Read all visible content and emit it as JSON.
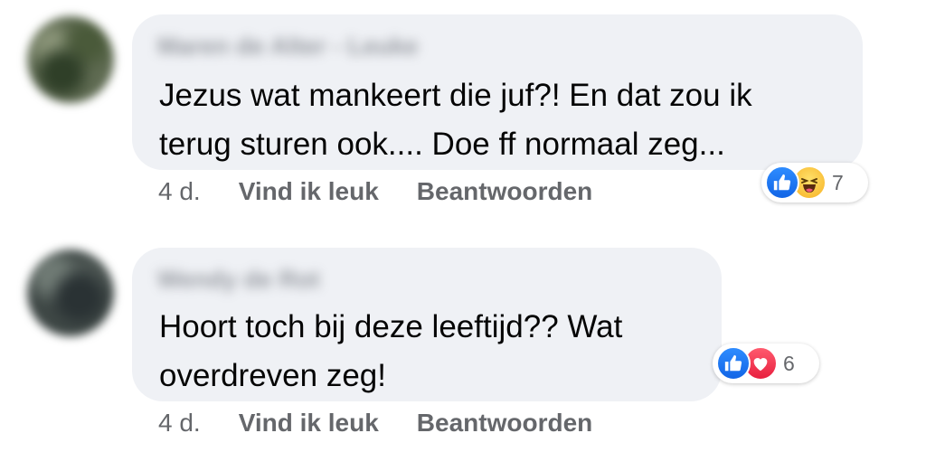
{
  "colors": {
    "bubble": "#eff1f5",
    "text": "#050505",
    "secondary": "#65676b",
    "like": "#1877f2",
    "love": "#f33e58",
    "haha": "#f7b125"
  },
  "comments": [
    {
      "author": "Maren de Alter - Leuke",
      "text_lines": [
        "Jezus wat mankeert die juf?! En dat zou ik",
        "terug sturen ook.... Doe ff normaal zeg..."
      ],
      "reactions": {
        "icons": [
          "like-icon",
          "haha-icon"
        ],
        "count": "7"
      },
      "timestamp": "4 d.",
      "like_label": "Vind ik leuk",
      "reply_label": "Beantwoorden"
    },
    {
      "author": "Wendy de Rot",
      "text_lines": [
        "Hoort toch bij deze leeftijd?? Wat",
        "overdreven zeg!"
      ],
      "reactions": {
        "icons": [
          "like-icon",
          "love-icon"
        ],
        "count": "6"
      },
      "timestamp": "4 d.",
      "like_label": "Vind ik leuk",
      "reply_label": "Beantwoorden"
    }
  ]
}
